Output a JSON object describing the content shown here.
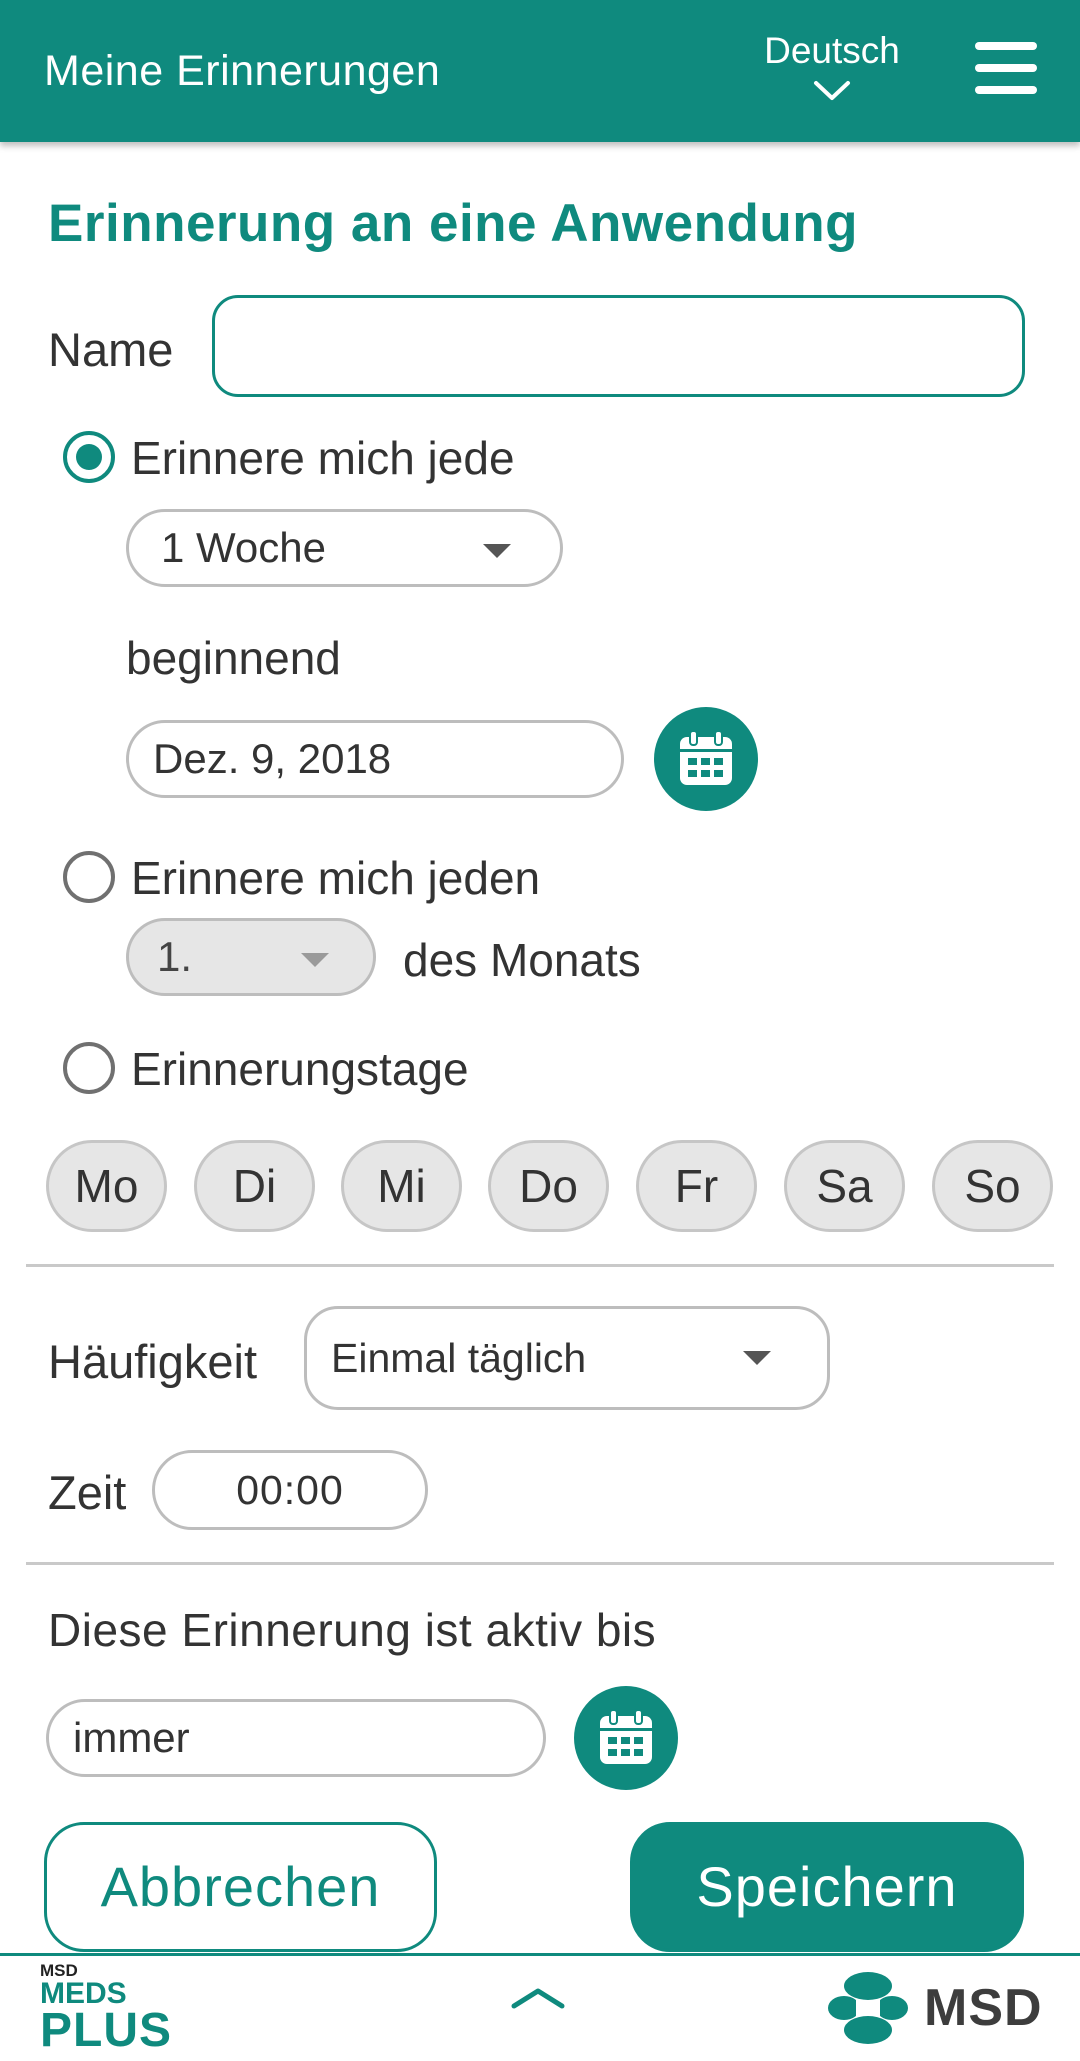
{
  "header": {
    "title": "Meine Erinnerungen",
    "language": "Deutsch",
    "language_icon": "chevron-down-icon",
    "menu_icon": "hamburger-menu-icon"
  },
  "form": {
    "heading": "Erinnerung an eine Anwendung",
    "name_label": "Name",
    "name_value": "",
    "option_every": {
      "label": "Erinnere mich jede",
      "selected": true,
      "interval_value": "1 Woche",
      "starting_label": "beginnend",
      "start_date": "Dez. 9, 2018"
    },
    "option_monthly": {
      "label": "Erinnere mich jeden",
      "selected": false,
      "day_value": "1.",
      "suffix": "des Monats"
    },
    "option_days": {
      "label": "Erinnerungstage",
      "selected": false,
      "days": [
        "Mo",
        "Di",
        "Mi",
        "Do",
        "Fr",
        "Sa",
        "So"
      ]
    },
    "frequency_label": "Häufigkeit",
    "frequency_value": "Einmal täglich",
    "time_label": "Zeit",
    "time_value": "00:00",
    "active_until_label": "Diese Erinnerung ist aktiv bis",
    "active_until_value": "immer",
    "calendar_icon": "calendar-icon"
  },
  "actions": {
    "cancel": "Abbrechen",
    "save": "Speichern"
  },
  "footer": {
    "left_logo_small": "MSD",
    "left_logo_line1": "MEDS",
    "left_logo_line2": "PLUS",
    "center_icon": "chevron-up-icon",
    "right_logo": "MSD"
  },
  "colors": {
    "primary": "#0f8a7e",
    "chip_bg": "#e6e6e6",
    "border": "#bdbdbd"
  }
}
